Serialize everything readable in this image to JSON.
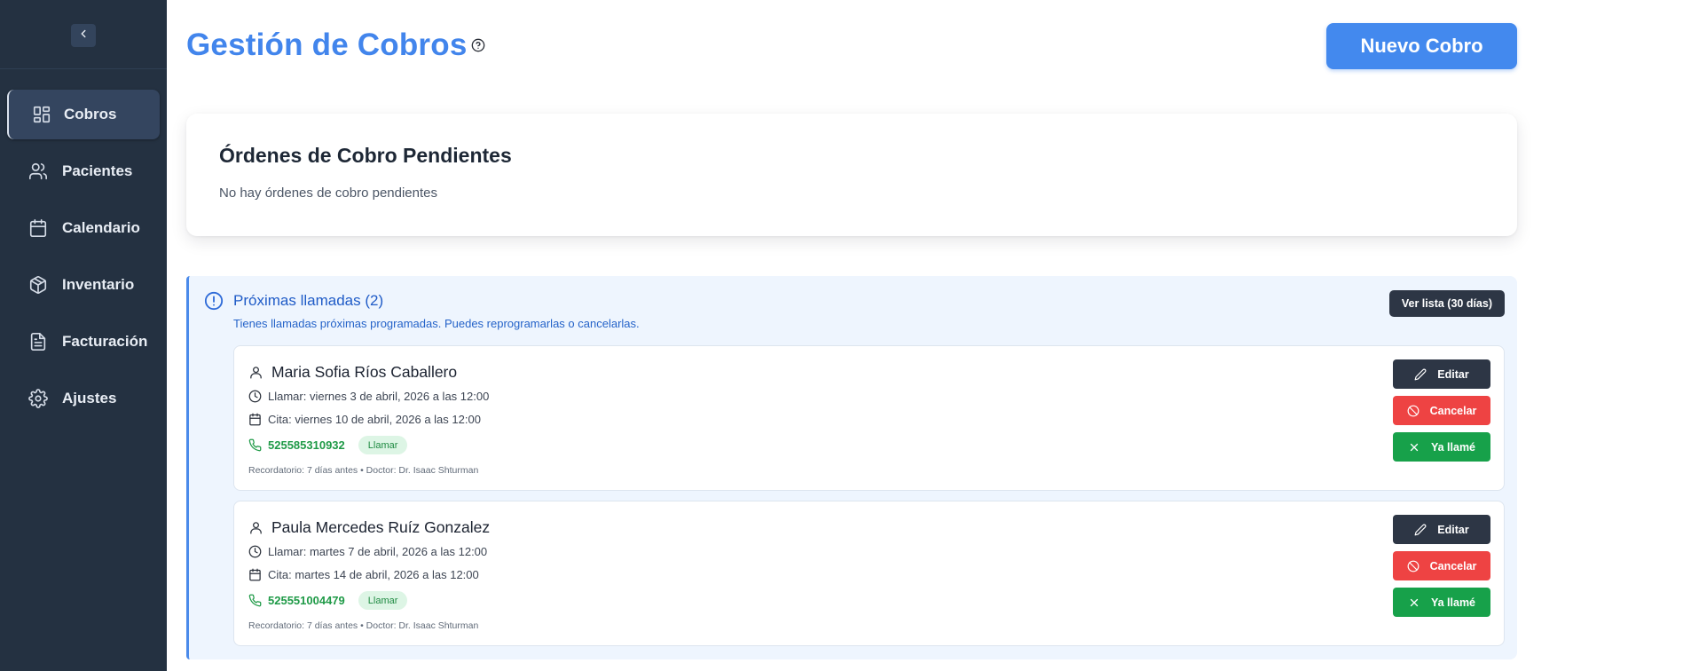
{
  "sidebar": {
    "collapse_icon": "chevron-left-icon",
    "items": [
      {
        "label": "Cobros",
        "icon": "grid-icon",
        "active": true
      },
      {
        "label": "Pacientes",
        "icon": "users-icon"
      },
      {
        "label": "Calendario",
        "icon": "calendar-icon"
      },
      {
        "label": "Inventario",
        "icon": "box-icon"
      },
      {
        "label": "Facturación",
        "icon": "document-icon"
      },
      {
        "label": "Ajustes",
        "icon": "gear-icon"
      }
    ]
  },
  "header": {
    "title": "Gestión de Cobros",
    "help_icon": "question-circle-icon",
    "new_button": "Nuevo Cobro"
  },
  "pending": {
    "title": "Órdenes de Cobro Pendientes",
    "empty_text": "No hay órdenes de cobro pendientes"
  },
  "calls": {
    "title": "Próximas llamadas (2)",
    "subtitle": "Tienes llamadas próximas programadas. Puedes reprogramarlas o cancelarlas.",
    "list_button": "Ver lista (30 días)",
    "items": [
      {
        "name": "Maria Sofia Ríos Caballero",
        "call_date": "Llamar: viernes 3 de abril, 2026 a las 12:00",
        "appointment": "Cita: viernes 10 de abril, 2026 a las 12:00",
        "phone": "525585310932",
        "badge": "Llamar",
        "meta": "Recordatorio: 7 días antes • Doctor: Dr. Isaac Shturman",
        "edit": "Editar",
        "cancel": "Cancelar",
        "called": "Ya llamé"
      },
      {
        "name": "Paula Mercedes Ruíz Gonzalez",
        "call_date": "Llamar: martes 7 de abril, 2026 a las 12:00",
        "appointment": "Cita: martes 14 de abril, 2026 a las 12:00",
        "phone": "525551004479",
        "badge": "Llamar",
        "meta": "Recordatorio: 7 días antes • Doctor: Dr. Isaac Shturman",
        "edit": "Editar",
        "cancel": "Cancelar",
        "called": "Ya llamé"
      }
    ]
  },
  "colors": {
    "sidebar_bg": "#243141",
    "accent": "#4285ec",
    "danger": "#ee4343",
    "success": "#17a14a",
    "dark_button": "#2d3645"
  }
}
